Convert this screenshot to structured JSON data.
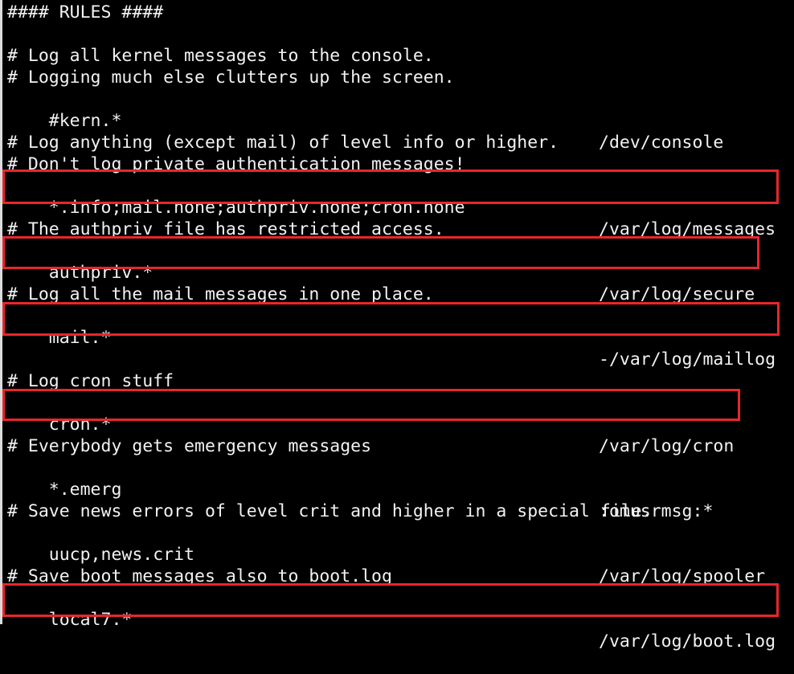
{
  "header": "#### RULES ####",
  "lines": [
    {
      "facility": "# Log all kernel messages to the console."
    },
    {
      "facility": "# Logging much else clutters up the screen."
    },
    {
      "facility": "#kern.*",
      "action": "/dev/console"
    },
    {
      "facility": "# Log anything (except mail) of level info or higher."
    },
    {
      "facility": "# Don't log private authentication messages!"
    },
    {
      "facility": "*.info;mail.none;authpriv.none;cron.none",
      "action": "/var/log/messages"
    },
    {
      "facility": "# The authpriv file has restricted access."
    },
    {
      "facility": "authpriv.*",
      "action": "/var/log/secure"
    },
    {
      "facility": "# Log all the mail messages in one place."
    },
    {
      "facility": "mail.*",
      "action": "-/var/log/maillog"
    },
    {
      "facility": "# Log cron stuff"
    },
    {
      "facility": "cron.*",
      "action": "/var/log/cron"
    },
    {
      "facility": "# Everybody gets emergency messages"
    },
    {
      "facility": "*.emerg",
      "action": ":omusrmsg:*"
    },
    {
      "facility": "# Save news errors of level crit and higher in a special file."
    },
    {
      "facility": "uucp,news.crit",
      "action": "/var/log/spooler"
    },
    {
      "facility": "# Save boot messages also to boot.log"
    },
    {
      "facility": "local7.*",
      "action": "/var/log/boot.log"
    }
  ],
  "colors": {
    "background": "#000000",
    "text": "#f2f2f2",
    "highlight_box": "#e8262c",
    "left_border": "#dcdcdc"
  }
}
